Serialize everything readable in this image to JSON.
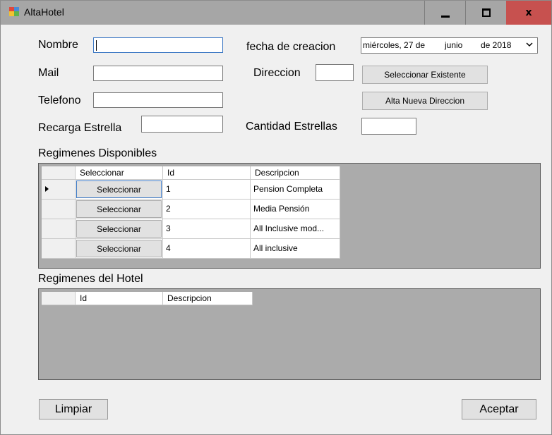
{
  "window": {
    "title": "AltaHotel",
    "minimize_icon": "minimize-icon",
    "maximize_icon": "maximize-icon",
    "close_icon": "close-icon",
    "close_glyph": "x"
  },
  "form": {
    "nombre_label": "Nombre",
    "mail_label": "Mail",
    "telefono_label": "Telefono",
    "recarga_label": "Recarga Estrella",
    "fecha_label": "fecha de creacion",
    "direccion_label": "Direccion",
    "cantidad_label": "Cantidad Estrellas",
    "nombre_value": "",
    "mail_value": "",
    "telefono_value": "",
    "recarga_value": "",
    "direccion_value": "",
    "cantidad_value": ""
  },
  "date": {
    "weekday_day": "miércoles, 27 de",
    "month": "junio",
    "year": "de 2018"
  },
  "buttons": {
    "seleccionar_existente": "Seleccionar Existente",
    "alta_nueva_direccion": "Alta Nueva Direccion",
    "limpiar": "Limpiar",
    "aceptar": "Aceptar"
  },
  "regimenes_disponibles": {
    "title": "Regimenes Disponibles",
    "columns": [
      "Seleccionar",
      "Id",
      "Descripcion"
    ],
    "rows": [
      {
        "button": "Seleccionar",
        "id": "1",
        "descripcion": "Pension Completa"
      },
      {
        "button": "Seleccionar",
        "id": "2",
        "descripcion": "Media Pensión"
      },
      {
        "button": "Seleccionar",
        "id": "3",
        "descripcion": "All Inclusive mod..."
      },
      {
        "button": "Seleccionar",
        "id": "4",
        "descripcion": "All inclusive"
      }
    ]
  },
  "regimenes_hotel": {
    "title": "Regimenes del Hotel",
    "columns": [
      "Id",
      "Descripcion"
    ]
  },
  "colors": {
    "titlebar": "#a6a6a6",
    "close_button": "#c7514f",
    "grid_background": "#ababab",
    "focus_border": "#3c78c4"
  }
}
